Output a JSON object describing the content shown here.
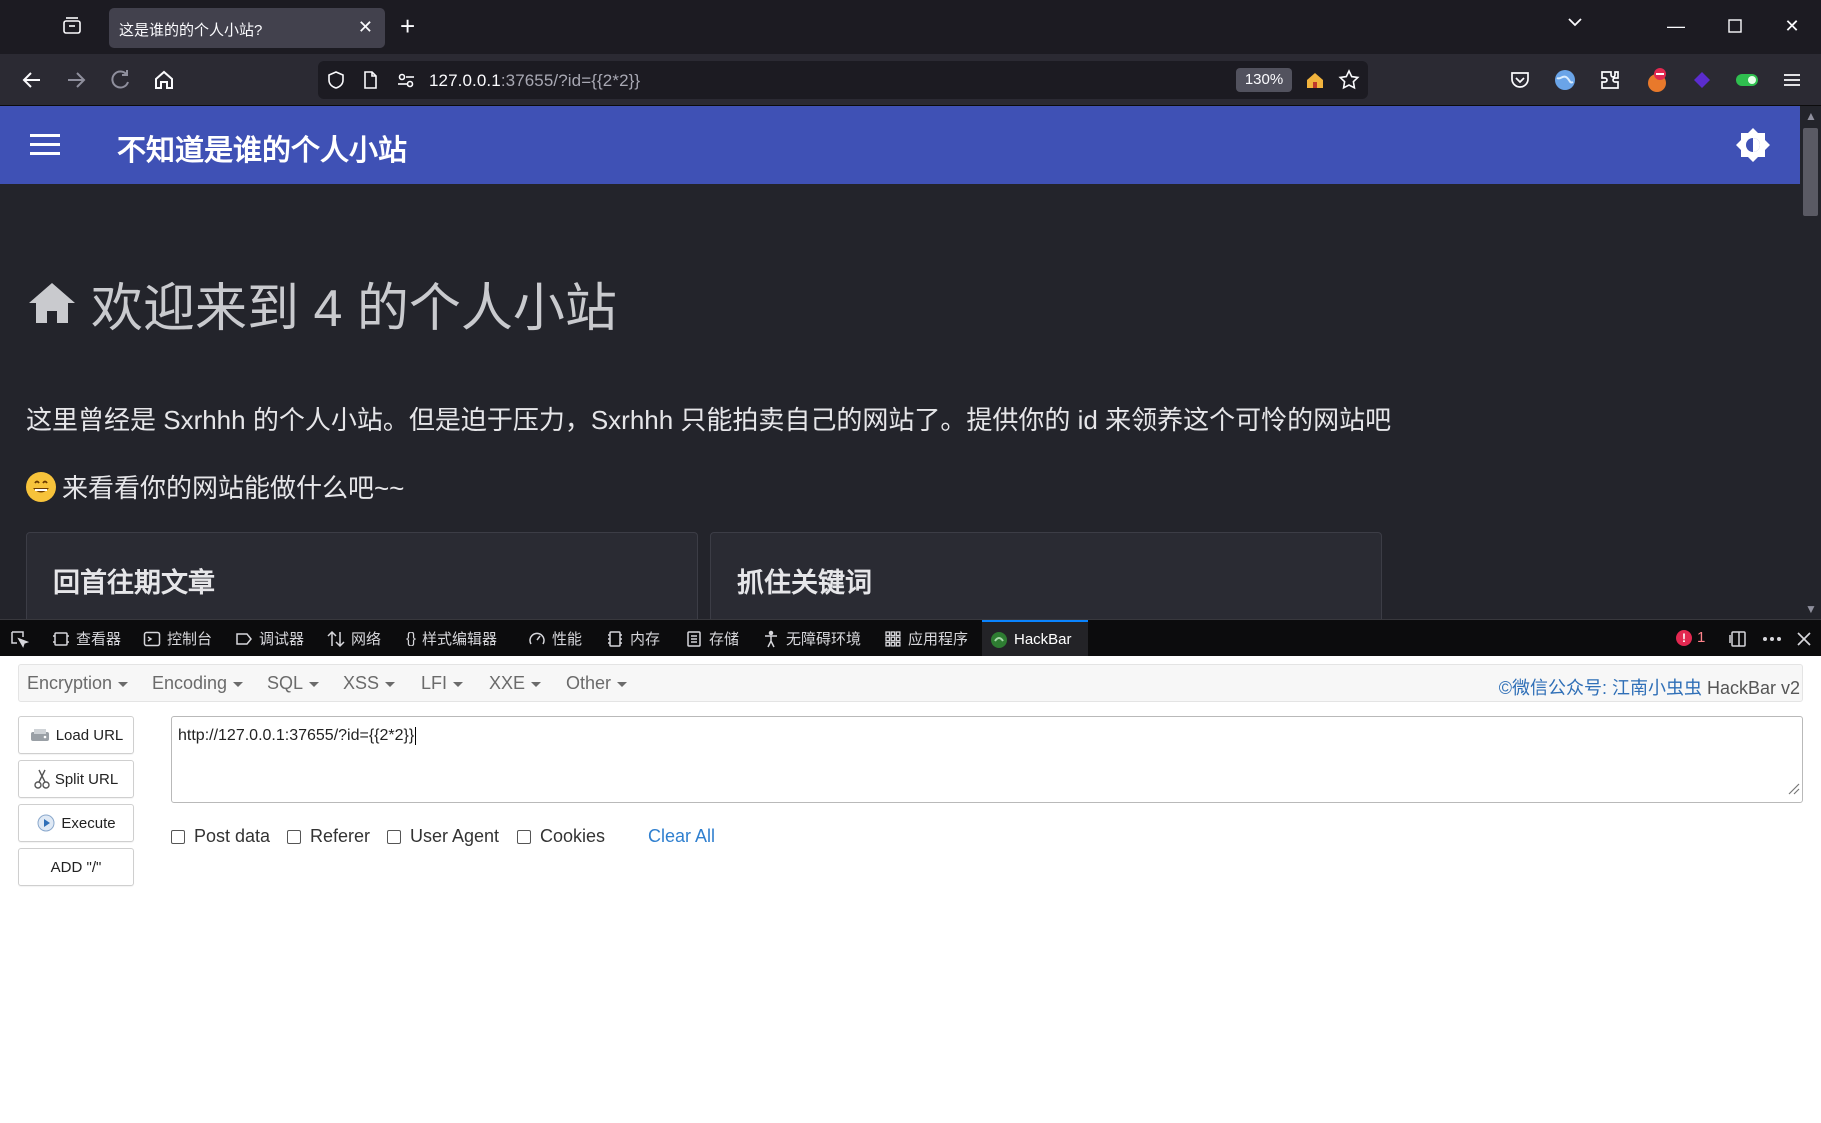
{
  "browser": {
    "tab_title": "这是谁的的个人小站?",
    "url_host": "127.0.0.1",
    "url_rest": ":37655/?id={{2*2}}",
    "zoom": "130%"
  },
  "site": {
    "title": "不知道是谁的个人小站",
    "welcome": "欢迎来到 4 的个人小站",
    "intro": "这里曾经是 Sxrhhh 的个人小站。但是迫于压力，Sxrhhh 只能拍卖自己的网站了。提供你的 id 来领养这个可怜的网站吧",
    "tagline": "来看看你的网站能做什么吧~~",
    "cards": [
      {
        "title": "回首往期文章"
      },
      {
        "title": "抓住关键词"
      }
    ]
  },
  "devtools": {
    "tabs": [
      {
        "label": "查看器",
        "icon": "inspector-icon"
      },
      {
        "label": "控制台",
        "icon": "console-icon"
      },
      {
        "label": "调试器",
        "icon": "debugger-icon"
      },
      {
        "label": "网络",
        "icon": "network-icon"
      },
      {
        "label": "样式编辑器",
        "icon": "style-editor-icon"
      },
      {
        "label": "性能",
        "icon": "performance-icon"
      },
      {
        "label": "内存",
        "icon": "memory-icon"
      },
      {
        "label": "存储",
        "icon": "storage-icon"
      },
      {
        "label": "无障碍环境",
        "icon": "accessibility-icon"
      },
      {
        "label": "应用程序",
        "icon": "application-icon"
      },
      {
        "label": "HackBar",
        "icon": "hackbar-icon"
      }
    ],
    "error_count": "1"
  },
  "hackbar": {
    "menu": [
      "Encryption",
      "Encoding",
      "SQL",
      "XSS",
      "LFI",
      "XXE",
      "Other"
    ],
    "credit_prefix": "©微信公众号: ",
    "credit_link": "江南小虫虫",
    "credit_suffix": " HackBar v2",
    "buttons": {
      "load_url": "Load URL",
      "split_url": "Split URL",
      "execute": "Execute",
      "add_slash": "ADD \"/\""
    },
    "url_value": "http://127.0.0.1:37655/?id={{2*2}}",
    "checkboxes": [
      "Post data",
      "Referer",
      "User Agent",
      "Cookies"
    ],
    "clear_all": "Clear All"
  },
  "colors": {
    "header_blue": "#3f51b5",
    "page_bg": "#23242b",
    "browser_chrome": "#1c1b22",
    "link_blue": "#2f7fcf"
  }
}
